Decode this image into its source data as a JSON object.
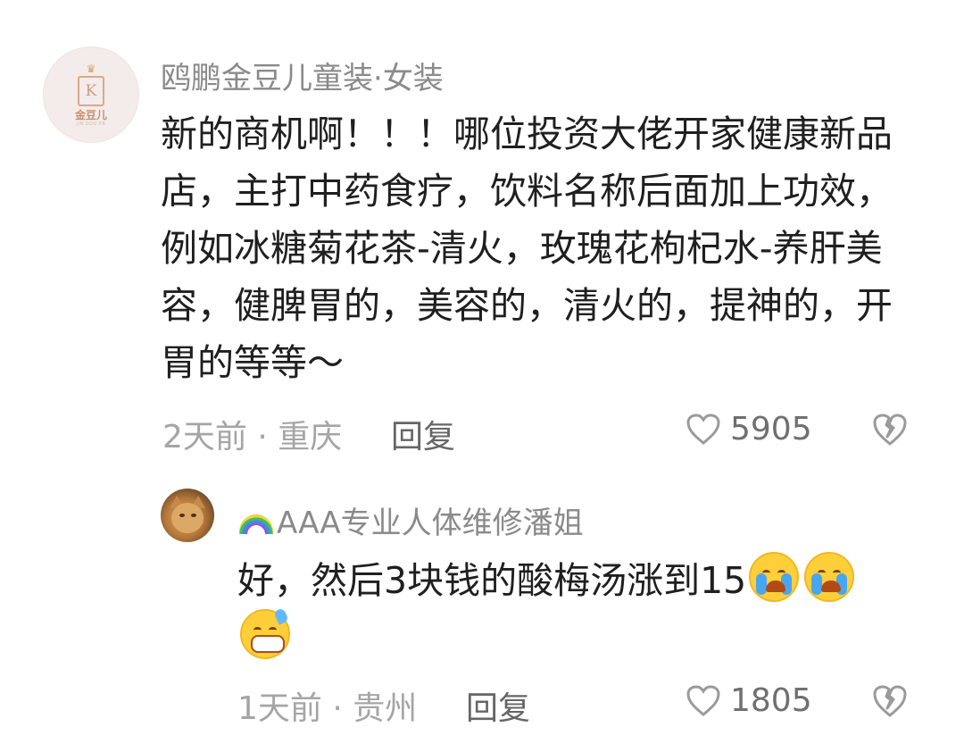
{
  "comments": [
    {
      "username": "鸥鹏金豆儿童装·女装",
      "avatar": {
        "type": "logo",
        "brand": "金豆儿",
        "letter": "K",
        "icon": "crown-icon",
        "tagline": "JIN DOU ER"
      },
      "text": "新的商机啊！！！哪位投资大佬开家健康新品店，主打中药食疗，饮料名称后面加上功效，例如冰糖菊花茶-清火，玫瑰花枸杞水-养肝美容，健脾胃的，美容的，清火的，提神的，开胃的等等～",
      "time": "2天前",
      "location": "重庆",
      "meta": "2天前 · 重庆",
      "reply_label": "回复",
      "likes": "5905",
      "like_icon": "heart-outline-icon",
      "dislike_icon": "broken-heart-icon"
    },
    {
      "username": "AAA专业人体维修潘姐",
      "username_prefix_icon": "rainbow-emoji",
      "avatar": {
        "type": "photo",
        "subject": "cat-photo"
      },
      "text": "好，然后3块钱的酸梅汤涨到15",
      "emojis": [
        "loudly-crying-face-emoji",
        "loudly-crying-face-emoji",
        "grinning-face-with-sweat-emoji"
      ],
      "time": "1天前",
      "location": "贵州",
      "meta": "1天前 · 贵州",
      "reply_label": "回复",
      "likes": "1805",
      "like_icon": "heart-outline-icon",
      "dislike_icon": "broken-heart-icon"
    }
  ],
  "colors": {
    "text": "#1f1f1f",
    "username": "#8a8a8a",
    "meta": "#a5a5a5",
    "reply": "#666666",
    "icon": "#9a9a9a",
    "background": "#ffffff"
  }
}
